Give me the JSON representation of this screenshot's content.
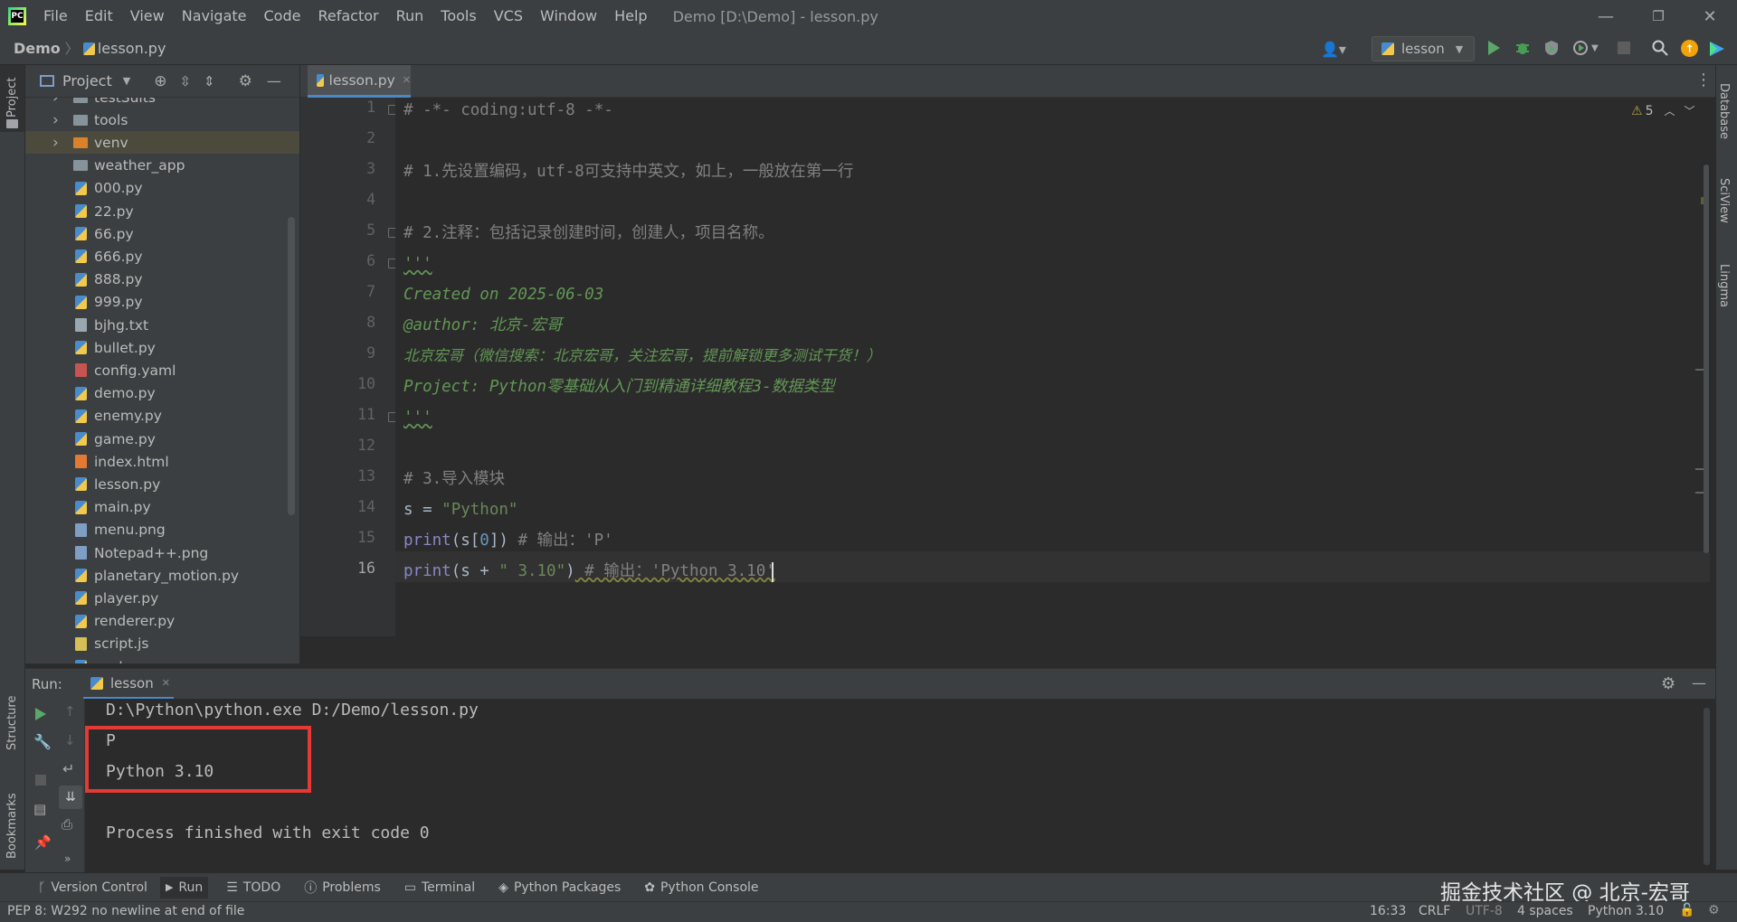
{
  "menubar": {
    "items": [
      "File",
      "Edit",
      "View",
      "Navigate",
      "Code",
      "Refactor",
      "Run",
      "Tools",
      "VCS",
      "Window",
      "Help"
    ],
    "window_title": "Demo [D:\\Demo] - lesson.py"
  },
  "navbar": {
    "project": "Demo",
    "file": "lesson.py",
    "run_config": "lesson"
  },
  "stripes": {
    "left_top": "Project",
    "left_structure": "Structure",
    "left_bookmarks": "Bookmarks",
    "right": [
      "Database",
      "SciView",
      "Lingma"
    ]
  },
  "project_panel": {
    "title": "Project",
    "items": [
      {
        "name": "testSuits",
        "type": "folder",
        "expandable": true
      },
      {
        "name": "tools",
        "type": "folder",
        "expandable": true
      },
      {
        "name": "venv",
        "type": "venv",
        "expandable": true
      },
      {
        "name": "weather_app",
        "type": "folder",
        "expandable": false
      },
      {
        "name": "000.py",
        "type": "py"
      },
      {
        "name": "22.py",
        "type": "py"
      },
      {
        "name": "66.py",
        "type": "py"
      },
      {
        "name": "666.py",
        "type": "py"
      },
      {
        "name": "888.py",
        "type": "py"
      },
      {
        "name": "999.py",
        "type": "py"
      },
      {
        "name": "bjhg.txt",
        "type": "txt"
      },
      {
        "name": "bullet.py",
        "type": "py"
      },
      {
        "name": "config.yaml",
        "type": "yaml"
      },
      {
        "name": "demo.py",
        "type": "py"
      },
      {
        "name": "enemy.py",
        "type": "py"
      },
      {
        "name": "game.py",
        "type": "py"
      },
      {
        "name": "index.html",
        "type": "html"
      },
      {
        "name": "lesson.py",
        "type": "py"
      },
      {
        "name": "main.py",
        "type": "py"
      },
      {
        "name": "menu.png",
        "type": "img"
      },
      {
        "name": "Notepad++.png",
        "type": "img"
      },
      {
        "name": "planetary_motion.py",
        "type": "py"
      },
      {
        "name": "player.py",
        "type": "py"
      },
      {
        "name": "renderer.py",
        "type": "py"
      },
      {
        "name": "script.js",
        "type": "js"
      },
      {
        "name": "snake_game.py",
        "type": "py"
      }
    ]
  },
  "editor": {
    "tab": "lesson.py",
    "warning_count": "5",
    "line_numbers": [
      "1",
      "2",
      "3",
      "4",
      "5",
      "6",
      "7",
      "8",
      "9",
      "10",
      "11",
      "12",
      "13",
      "14",
      "15",
      "16"
    ],
    "lines": {
      "l1": "# -*- coding:utf-8 -*-",
      "l3": "# 1.先设置编码，utf-8可支持中英文，如上，一般放在第一行",
      "l5": "# 2.注释：包括记录创建时间，创建人，项目名称。",
      "l6": "'''",
      "l7": "Created on 2025-06-03",
      "l8": "@author: 北京-宏哥",
      "l9": "北京宏哥（微信搜索：北京宏哥，关注宏哥，提前解锁更多测试干货！）",
      "l10": "Project: Python零基础从入门到精通详细教程3-数据类型",
      "l11": "'''",
      "l13": "# 3.导入模块",
      "l14_var": "s",
      "l14_op": " = ",
      "l14_str": "\"Python\"",
      "l15_fn": "print",
      "l15_a": "(s[",
      "l15_num": "0",
      "l15_b": "])",
      "l15_cmt": " # 输出：'P'",
      "l16_fn": "print",
      "l16_a": "(s + ",
      "l16_str": "\" 3.10\"",
      "l16_b": ")",
      "l16_cmt": " # 输出：'Python 3.10'"
    }
  },
  "run_panel": {
    "label": "Run:",
    "tab": "lesson",
    "output": [
      "D:\\Python\\python.exe D:/Demo/lesson.py",
      "P",
      "Python 3.10",
      "",
      "Process finished with exit code 0"
    ]
  },
  "tool_windows": [
    "Version Control",
    "Run",
    "TODO",
    "Problems",
    "Terminal",
    "Python Packages",
    "Python Console"
  ],
  "watermark": "掘金技术社区 @ 北京-宏哥",
  "statusbar": {
    "message": "PEP 8: W292 no newline at end of file",
    "position": "16:33",
    "line_sep": "CRLF",
    "encoding": "UTF-8",
    "indent": "4 spaces",
    "interpreter": "Python 3.10"
  },
  "colors": {
    "highlight_box": "#e53935",
    "run_green": "#59a869",
    "debug_green": "#499c54"
  }
}
